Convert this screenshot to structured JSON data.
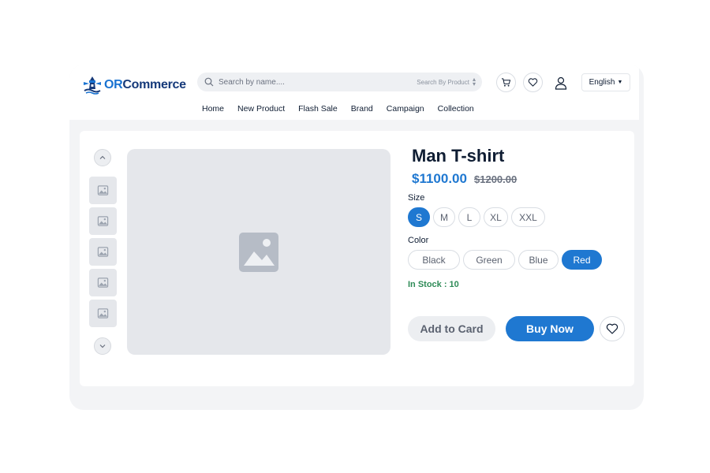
{
  "header": {
    "logo": {
      "prefix": "OR",
      "suffix": "Commerce"
    },
    "search": {
      "placeholder": "Search by name....",
      "filter_label": "Search By Product"
    },
    "language": "English",
    "nav": [
      "Home",
      "New Product",
      "Flash Sale",
      "Brand",
      "Campaign",
      "Collection"
    ]
  },
  "product": {
    "title": "Man T-shirt",
    "price": "$1100.00",
    "old_price": "$1200.00",
    "size_label": "Size",
    "sizes": [
      "S",
      "M",
      "L",
      "XL",
      "XXL"
    ],
    "selected_size": "S",
    "color_label": "Color",
    "colors": [
      "Black",
      "Green",
      "Blue",
      "Red"
    ],
    "selected_color": "Red",
    "stock": "In Stock : 10",
    "add_to_cart": "Add to Card",
    "buy_now": "Buy Now"
  },
  "icons": {
    "brand": "lighthouse-icon",
    "search": "search-icon",
    "cart": "cart-icon",
    "wishlist": "heart-icon",
    "account": "user-icon",
    "placeholder": "image-placeholder-icon"
  },
  "colors": {
    "accent": "#1f78d1",
    "stock": "#2e8b57",
    "brand_dark": "#163a7a"
  }
}
